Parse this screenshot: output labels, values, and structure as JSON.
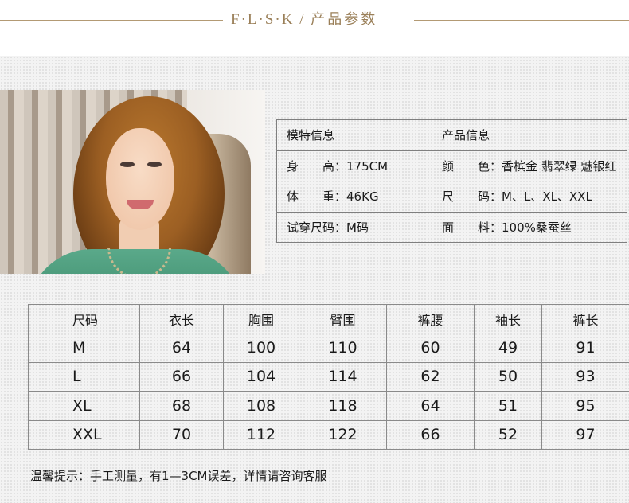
{
  "header": {
    "brand": "F·L·S·K",
    "separator": "/",
    "section_title": "产品参数",
    "accent_color": "#9a7f58"
  },
  "photo": {
    "icon": "model-photo"
  },
  "model_info": {
    "heading": "模特信息",
    "height_label": "身　　高：",
    "height_value": "175CM",
    "weight_label": "体　　重：",
    "weight_value": "46KG",
    "trial_label": "试穿尺码：",
    "trial_value": "M码"
  },
  "product_info": {
    "heading": "产品信息",
    "color_label": "颜　　色：",
    "color_value": "香槟金 翡翠绿 魅银红",
    "size_label": "尺　　码：",
    "size_value": "M、L、XL、XXL",
    "fabric_label": "面　　料：",
    "fabric_value": "100%桑蚕丝"
  },
  "size_chart": {
    "headers": [
      "尺码",
      "衣长",
      "胸围",
      "臂围",
      "裤腰",
      "袖长",
      "裤长"
    ],
    "rows": [
      [
        "M",
        "64",
        "100",
        "110",
        "60",
        "49",
        "91"
      ],
      [
        "L",
        "66",
        "104",
        "114",
        "62",
        "50",
        "93"
      ],
      [
        "XL",
        "68",
        "108",
        "118",
        "64",
        "51",
        "95"
      ],
      [
        "XXL",
        "70",
        "112",
        "122",
        "66",
        "52",
        "97"
      ]
    ]
  },
  "tip": "温馨提示：手工测量，有1—3CM误差，详情请咨询客服"
}
